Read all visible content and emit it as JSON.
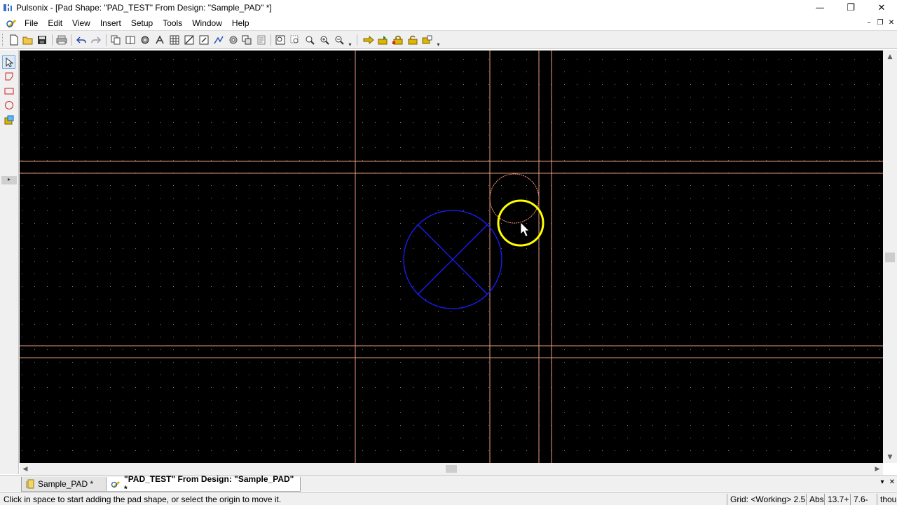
{
  "window": {
    "title": "Pulsonix - [Pad Shape: \"PAD_TEST\"  From Design: \"Sample_PAD\" *]",
    "minimize_glyph": "—",
    "maximize_glyph": "❐",
    "close_glyph": "✕"
  },
  "menu": {
    "items": [
      {
        "label": "File"
      },
      {
        "label": "Edit"
      },
      {
        "label": "View"
      },
      {
        "label": "Insert"
      },
      {
        "label": "Setup"
      },
      {
        "label": "Tools"
      },
      {
        "label": "Window"
      },
      {
        "label": "Help"
      }
    ],
    "mdi_minimize": "–",
    "mdi_restore": "❐",
    "mdi_close": "✕"
  },
  "toolbar": {
    "icons": [
      "new-file-icon",
      "open-folder-icon",
      "save-icon",
      "print-icon",
      "undo-icon",
      "redo-icon",
      "copy-icon",
      "book-icon",
      "component-icon",
      "net-icon",
      "grid-icon",
      "measure-icon",
      "select-icon",
      "route-icon",
      "via-icon",
      "layers-icon",
      "report-icon",
      "zoom-all-icon",
      "zoom-area-icon",
      "zoom-window-icon",
      "zoom-in-icon",
      "zoom-out-icon",
      "move-right-icon",
      "insert-icon",
      "lock-icon",
      "unlock-icon",
      "align-icon"
    ]
  },
  "left_toolbar": {
    "icons": [
      "select-pointer-icon",
      "polygon-icon",
      "rectangle-icon",
      "circle-icon",
      "shape-fill-icon"
    ]
  },
  "canvas": {
    "background": "#000000",
    "grid_dot_color": "#7a7a7a",
    "guide_color": "#e89a7c",
    "pad_circle_color": "#1c1cff",
    "highlight_color": "#ffff00",
    "ghost_circle_color": "#ff9a7a"
  },
  "scrollbars": {
    "up": "▲",
    "down": "▼",
    "left": "◀",
    "right": "▶"
  },
  "tabs": [
    {
      "label": "Sample_PAD *"
    },
    {
      "label": "\"PAD_TEST\"  From Design: \"Sample_PAD\" *"
    }
  ],
  "tab_controls": {
    "dropdown": "▾",
    "close": "✕"
  },
  "status": {
    "message": "Click in space to start adding the pad shape, or select the origin to move it.",
    "grid": "Grid: <Working> 2.5",
    "mode": "Abs",
    "x": "13.7+",
    "y": "7.6-",
    "units": "thou"
  }
}
